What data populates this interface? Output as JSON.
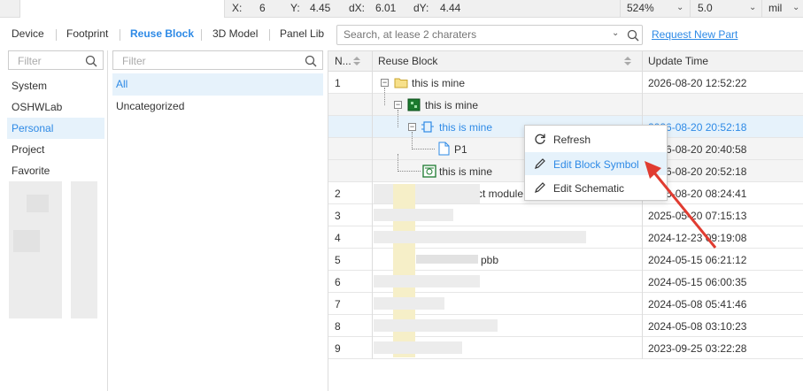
{
  "status_bar": {
    "x_label": "X:",
    "x_value": "6",
    "y_label": "Y:",
    "y_value": "4.45",
    "dx_label": "dX:",
    "dx_value": "6.01",
    "dy_label": "dY:",
    "dy_value": "4.44",
    "zoom": "524%",
    "grid": "5.0",
    "unit": "mil"
  },
  "tabs": [
    "Device",
    "Footprint",
    "Reuse Block",
    "3D Model",
    "Panel Lib"
  ],
  "active_tab": "Reuse Block",
  "search": {
    "placeholder": "Search, at lease 2 charaters"
  },
  "request_link": "Request New Part",
  "left_filter": {
    "placeholder": "Filter"
  },
  "categories": [
    "System",
    "OSHWLab",
    "Personal",
    "Project",
    "Favorite"
  ],
  "selected_category": "Personal",
  "sub_filter": {
    "placeholder": "Filter"
  },
  "subcategories": [
    "All",
    "Uncategorized"
  ],
  "selected_subcategory": "All",
  "table": {
    "headers": {
      "no": "N...",
      "block": "Reuse Block",
      "time": "Update Time"
    },
    "rows": [
      {
        "no": "1",
        "name": "this is mine",
        "time": "2026-08-20 12:52:22"
      },
      {
        "no": "",
        "name": "this is mine",
        "time": ""
      },
      {
        "no": "",
        "name": "this is mine",
        "time": "2026-08-20 20:52:18"
      },
      {
        "no": "",
        "name": "P1",
        "time": "2026-08-20 20:40:58"
      },
      {
        "no": "",
        "name": "this is mine",
        "time": "2026-08-20 20:52:18"
      },
      {
        "no": "2",
        "name": "ct module",
        "time": "2026-08-20 08:24:41"
      },
      {
        "no": "3",
        "name": "",
        "time": "2025-05-20 07:15:13"
      },
      {
        "no": "4",
        "name": "",
        "time": "2024-12-23 09:19:08"
      },
      {
        "no": "5",
        "name": "pbb",
        "time": "2024-05-15 06:21:12"
      },
      {
        "no": "6",
        "name": "",
        "time": "2024-05-15 06:00:35"
      },
      {
        "no": "7",
        "name": "",
        "time": "2024-05-08 05:41:46"
      },
      {
        "no": "8",
        "name": "",
        "time": "2024-05-08 03:10:23"
      },
      {
        "no": "9",
        "name": "",
        "time": "2023-09-25 03:22:28"
      }
    ]
  },
  "context_menu": {
    "items": [
      "Refresh",
      "Edit Block Symbol",
      "Edit Schematic"
    ],
    "highlighted": "Edit Block Symbol"
  },
  "colors": {
    "accent": "#2e8ae6",
    "selection": "#e6f2fb",
    "arrow": "#e03c31"
  }
}
